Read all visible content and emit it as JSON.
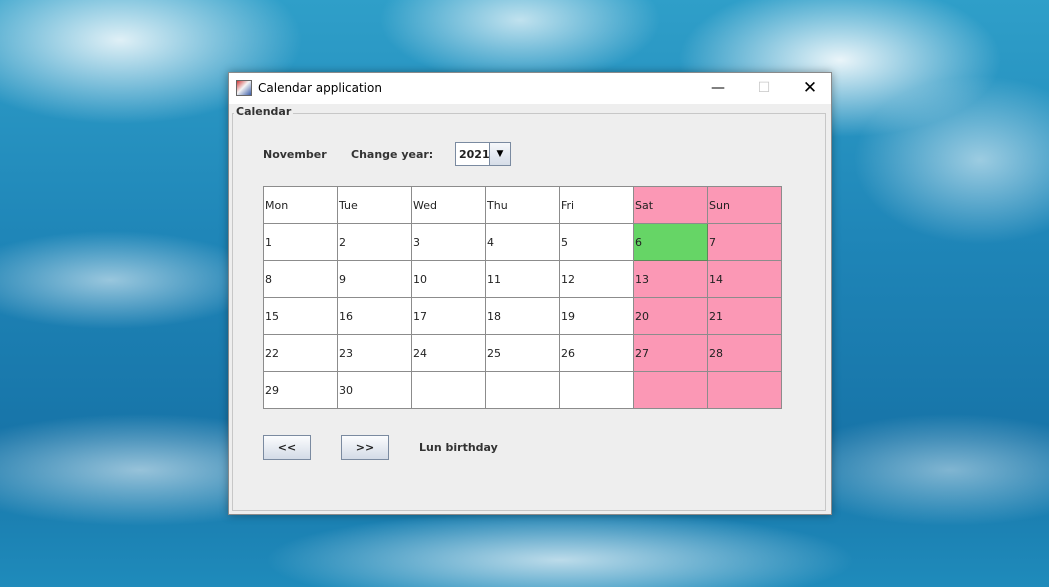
{
  "window": {
    "title": "Calendar application",
    "controls": {
      "minimize": "—",
      "maximize": "☐",
      "close": "✕"
    }
  },
  "panel": {
    "legend": "Calendar"
  },
  "header": {
    "month": "November",
    "year_label": "Change year:",
    "year_value": "2021"
  },
  "calendar": {
    "weekdays": [
      "Mon",
      "Tue",
      "Wed",
      "Thu",
      "Fri",
      "Sat",
      "Sun"
    ],
    "weeks": [
      [
        "1",
        "2",
        "3",
        "4",
        "5",
        "6",
        "7"
      ],
      [
        "8",
        "9",
        "10",
        "11",
        "12",
        "13",
        "14"
      ],
      [
        "15",
        "16",
        "17",
        "18",
        "19",
        "20",
        "21"
      ],
      [
        "22",
        "23",
        "24",
        "25",
        "26",
        "27",
        "28"
      ],
      [
        "29",
        "30",
        "",
        "",
        "",
        "",
        ""
      ]
    ],
    "highlighted_day": "6",
    "weekend_color": "#fb98b5",
    "highlight_color": "#66d566"
  },
  "footer": {
    "prev_label": "<<",
    "next_label": ">>",
    "event_text": "Lun birthday"
  }
}
